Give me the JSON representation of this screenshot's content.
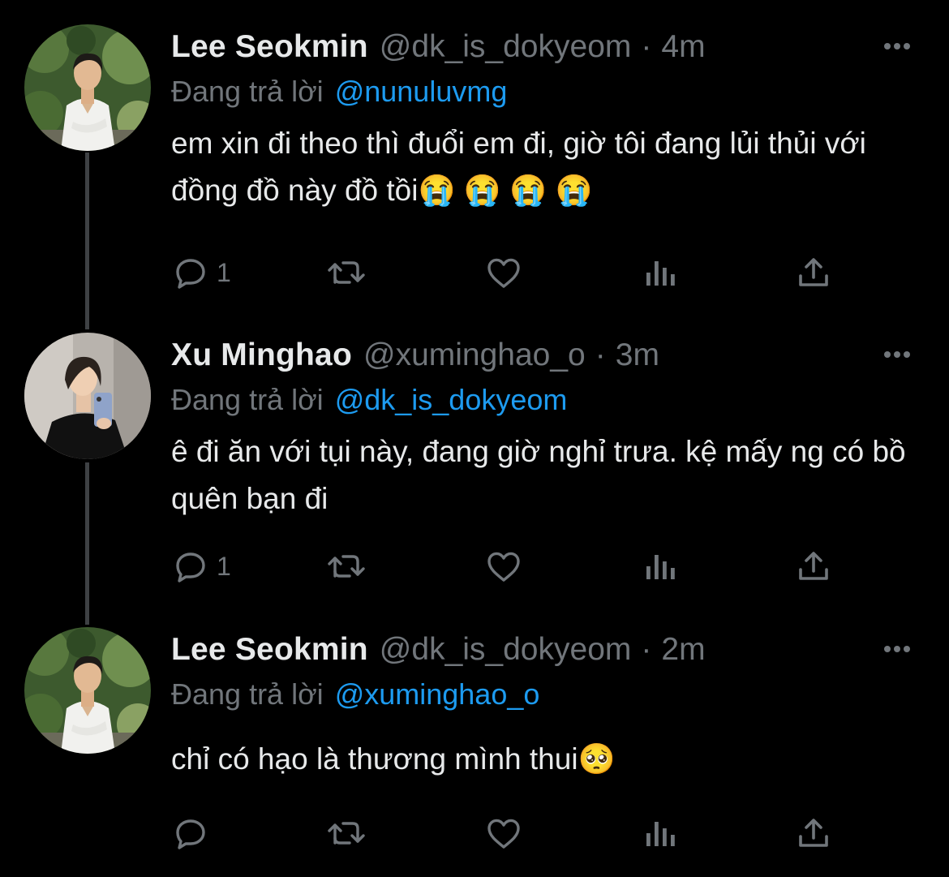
{
  "colors": {
    "background": "#000000",
    "text": "#e7e9ea",
    "muted": "#71767b",
    "link": "#1d9bf0",
    "thread_line": "#3e4144"
  },
  "tweets": [
    {
      "display_name": "Lee Seokmin",
      "handle": "@dk_is_dokyeom",
      "separator": "·",
      "time": "4m",
      "reply_prefix": "Đang trả lời",
      "reply_to": "@nunuluvmg",
      "text": "em xin đi theo thì đuổi em đi, giờ tôi đang lủi thủi với đồng đồ này đồ tồi😭 😭 😭 😭",
      "reply_count": "1",
      "icons": [
        "reply-icon",
        "retweet-icon",
        "like-icon",
        "views-icon",
        "share-icon",
        "more-icon"
      ]
    },
    {
      "display_name": "Xu Minghao",
      "handle": "@xuminghao_o",
      "separator": "·",
      "time": "3m",
      "reply_prefix": "Đang trả lời",
      "reply_to": "@dk_is_dokyeom",
      "text": "ê đi ăn với tụi này, đang giờ nghỉ trưa. kệ mấy ng có bồ quên bạn đi",
      "reply_count": "1",
      "icons": [
        "reply-icon",
        "retweet-icon",
        "like-icon",
        "views-icon",
        "share-icon",
        "more-icon"
      ]
    },
    {
      "display_name": "Lee Seokmin",
      "handle": "@dk_is_dokyeom",
      "separator": "·",
      "time": "2m",
      "reply_prefix": "Đang trả lời",
      "reply_to": "@xuminghao_o",
      "text": "chỉ có hạo là thương mình thui🥺",
      "reply_count": "",
      "icons": [
        "reply-icon",
        "retweet-icon",
        "like-icon",
        "views-icon",
        "share-icon",
        "more-icon"
      ]
    }
  ]
}
